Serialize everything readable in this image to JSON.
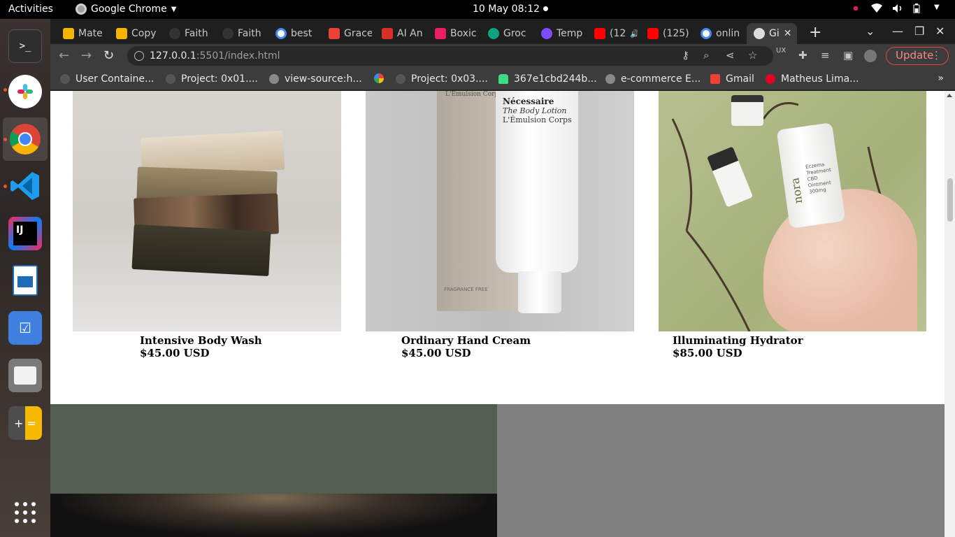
{
  "system_bar": {
    "activities": "Activities",
    "app_name": "Google Chrome",
    "clock": "10 May  08:12"
  },
  "tabs": [
    {
      "label": "Mate",
      "favicon_color": "#f4b400"
    },
    {
      "label": "Copy",
      "favicon_color": "#f4b400"
    },
    {
      "label": "Faith",
      "favicon_color": "#333333"
    },
    {
      "label": "Faith",
      "favicon_color": "#333333"
    },
    {
      "label": "best",
      "favicon_color": "#ffffff"
    },
    {
      "label": "Grace",
      "favicon_color": "#ea4335"
    },
    {
      "label": "AI An",
      "favicon_color": "#d93025"
    },
    {
      "label": "Boxic",
      "favicon_color": "#e91e63"
    },
    {
      "label": "Groc",
      "favicon_color": "#10a37f"
    },
    {
      "label": "Temp",
      "favicon_color": "#7c4dff"
    },
    {
      "label": "(12",
      "favicon_color": "#ff0000"
    },
    {
      "label": "(125)",
      "favicon_color": "#ff0000"
    },
    {
      "label": "onlin",
      "favicon_color": "#ffffff"
    },
    {
      "label": "Gi",
      "favicon_color": "#dddddd"
    }
  ],
  "address_bar": {
    "host": "127.0.0.1",
    "path": ":5501/index.html",
    "update_label": "Update"
  },
  "bookmarks": [
    {
      "label": "User Containe...",
      "icon_color": "#555555"
    },
    {
      "label": "Project: 0x01....",
      "icon_color": "#555555"
    },
    {
      "label": "view-source:h...",
      "icon_color": "#888888"
    },
    {
      "label": "",
      "icon_color": "#fbbc05"
    },
    {
      "label": "Project: 0x03....",
      "icon_color": "#555555"
    },
    {
      "label": "367e1cbd244b...",
      "icon_color": "#3ddc84"
    },
    {
      "label": "e-commerce E...",
      "icon_color": "#888888"
    },
    {
      "label": "Gmail",
      "icon_color": "#ea4335"
    },
    {
      "label": "Matheus Lima...",
      "icon_color": "#e60023"
    }
  ],
  "products": [
    {
      "name": "Intensive Body Wash",
      "price": "$45.00 USD"
    },
    {
      "name": "Ordinary Hand Cream",
      "price": "$45.00 USD"
    },
    {
      "name": "Illuminating Hydrator",
      "price": "$85.00 USD"
    }
  ],
  "lotion_label": {
    "brand": "Nécessaire",
    "line1": "The Body Lotion",
    "line2": "L'Émulsion Corps",
    "box_brand": "L'Émulsion Corps",
    "fragrance": "FRAGRANCE FREE"
  },
  "hydrator_label": {
    "brand": "nora",
    "text": "Eczema Treatment CBD Ointment 300mg"
  },
  "dock": [
    {
      "name": "terminal-icon"
    },
    {
      "name": "slack-icon"
    },
    {
      "name": "chrome-icon"
    },
    {
      "name": "vscode-icon"
    },
    {
      "name": "intellij-icon"
    },
    {
      "name": "libreoffice-impress-icon"
    },
    {
      "name": "tasks-icon"
    },
    {
      "name": "files-icon"
    },
    {
      "name": "calculator-icon"
    },
    {
      "name": "app-grid-icon"
    }
  ]
}
